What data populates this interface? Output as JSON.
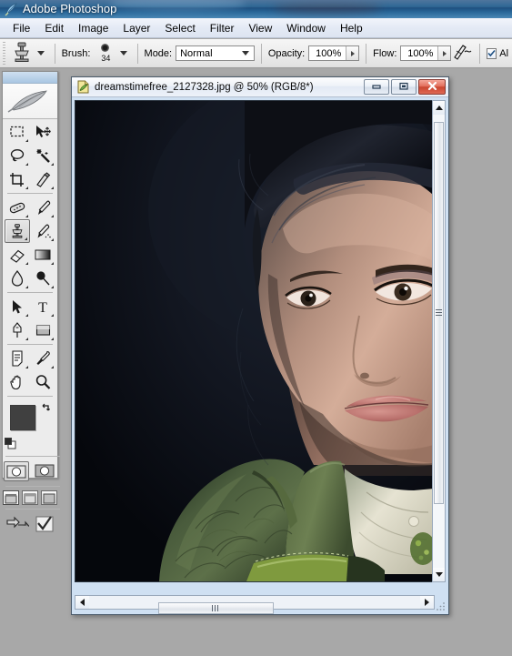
{
  "app": {
    "title": "Adobe Photoshop",
    "icon": "photoshop-feather-icon",
    "workspace_color": "#a8a8a8",
    "titlebar_color": "#23608f"
  },
  "menubar": {
    "items": [
      {
        "label": "File"
      },
      {
        "label": "Edit"
      },
      {
        "label": "Image"
      },
      {
        "label": "Layer"
      },
      {
        "label": "Select"
      },
      {
        "label": "Filter"
      },
      {
        "label": "View"
      },
      {
        "label": "Window"
      },
      {
        "label": "Help"
      }
    ]
  },
  "options_bar": {
    "tool_preset_icon": "clone-stamp-icon",
    "brush_label": "Brush:",
    "brush_size": "34",
    "mode_label": "Mode:",
    "mode_value": "Normal",
    "opacity_label": "Opacity:",
    "opacity_value": "100%",
    "flow_label": "Flow:",
    "flow_value": "100%",
    "airbrush_icon": "airbrush-icon",
    "aligned_label": "Al",
    "aligned_checked": true
  },
  "toolbox": {
    "logo": "photoshop-feather-logo",
    "selected_tool": "clone-stamp",
    "tools": [
      {
        "name": "rectangular-marquee",
        "has_flyout": true
      },
      {
        "name": "move",
        "has_flyout": false
      },
      {
        "name": "lasso",
        "has_flyout": true
      },
      {
        "name": "magic-wand",
        "has_flyout": true
      },
      {
        "name": "crop",
        "has_flyout": true
      },
      {
        "name": "slice",
        "has_flyout": true
      },
      {
        "name": "healing-brush",
        "has_flyout": true
      },
      {
        "name": "brush",
        "has_flyout": true
      },
      {
        "name": "clone-stamp",
        "has_flyout": true
      },
      {
        "name": "history-brush",
        "has_flyout": true
      },
      {
        "name": "eraser",
        "has_flyout": true
      },
      {
        "name": "gradient",
        "has_flyout": true
      },
      {
        "name": "blur",
        "has_flyout": true
      },
      {
        "name": "dodge",
        "has_flyout": true
      },
      {
        "name": "path-selection",
        "has_flyout": true
      },
      {
        "name": "type",
        "has_flyout": true
      },
      {
        "name": "pen",
        "has_flyout": true
      },
      {
        "name": "rectangle-shape",
        "has_flyout": true
      },
      {
        "name": "notes",
        "has_flyout": true
      },
      {
        "name": "eyedropper",
        "has_flyout": true
      },
      {
        "name": "hand",
        "has_flyout": false
      },
      {
        "name": "zoom",
        "has_flyout": false
      }
    ],
    "foreground_color": "#404040",
    "background_color": "#cfcbc4",
    "swap_icon": "swap-colors-icon",
    "default_colors_icon": "default-colors-icon",
    "quick_mask": {
      "standard_label": "standard-mode",
      "quickmask_label": "quick-mask-mode",
      "selected": "standard-mode"
    },
    "screen_modes": [
      "standard-screen-mode",
      "full-screen-with-menubar",
      "full-screen-mode"
    ],
    "screen_mode_selected": "standard-screen-mode",
    "jump_buttons": [
      "jump-to-imageready",
      "jump-to-edit"
    ]
  },
  "document": {
    "icon": "psd-document-icon",
    "title": "dreamstimefree_2127328.jpg @ 50% (RGB/8*)",
    "filename": "dreamstimefree_2127328.jpg",
    "zoom": "50%",
    "color_mode": "RGB/8*",
    "window_buttons": {
      "minimize": "minimize-icon",
      "restore": "restore-icon",
      "close": "close-icon"
    },
    "image": {
      "description": "Portrait photograph of a woman with dark hair against a near-black background, wearing an olive-green brocade jacket with a white lace collar",
      "background_color": "#0b0d14",
      "jacket_color": "#4a5f3f",
      "skin_color": "#c9a190",
      "hair_color": "#14161d"
    },
    "scrollbars": {
      "vertical": {
        "up_arrow": "scroll-up-icon",
        "down_arrow": "scroll-down-icon"
      },
      "horizontal": {
        "left_arrow": "scroll-left-icon",
        "right_arrow": "scroll-right-icon"
      }
    }
  }
}
